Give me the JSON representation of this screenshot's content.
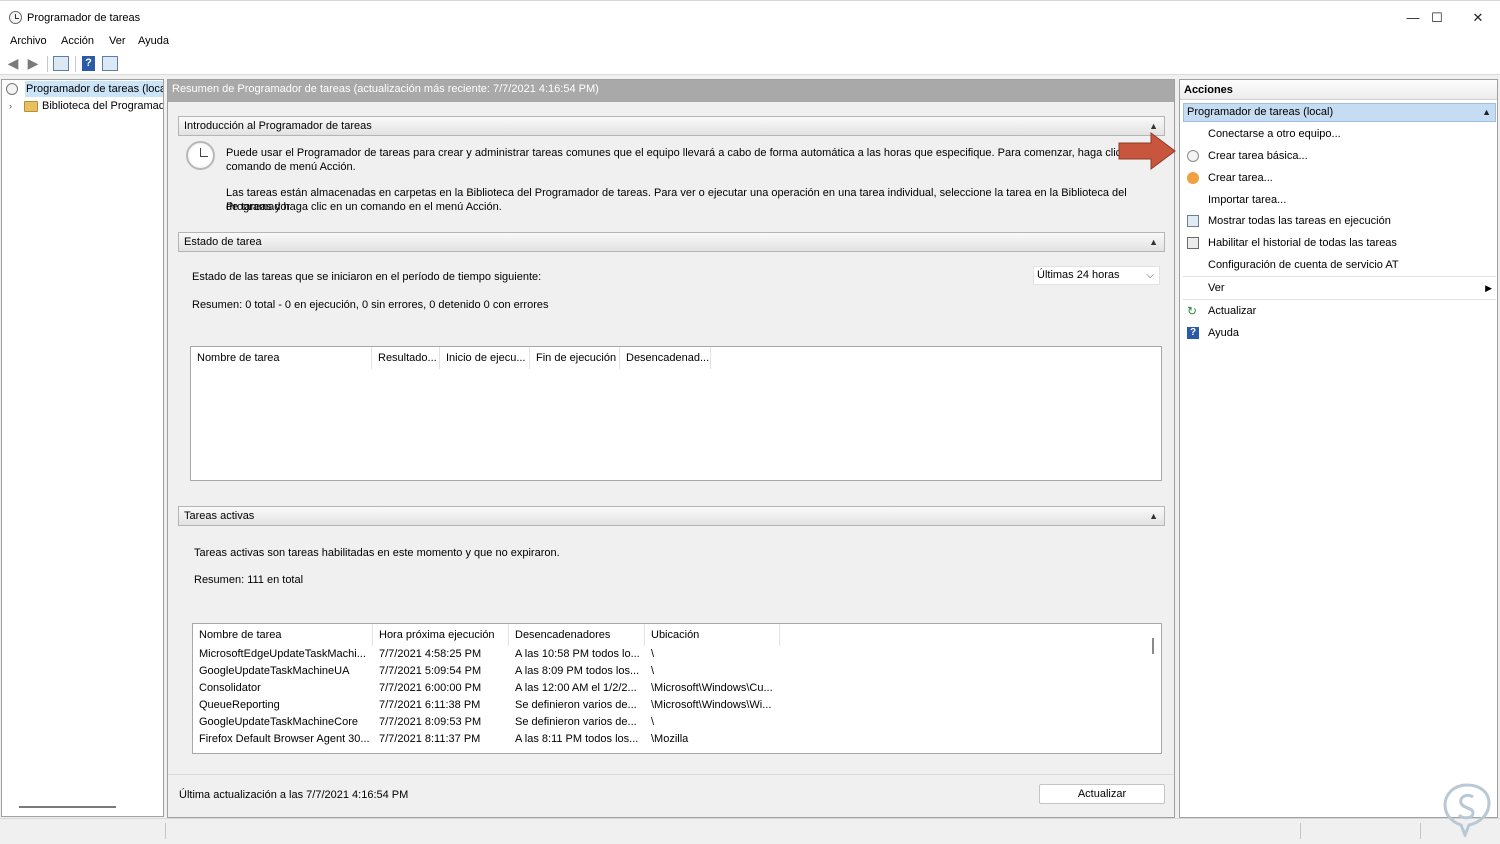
{
  "window": {
    "title": "Programador de tareas",
    "controls": {
      "minimize": "—",
      "maximize": "☐",
      "close": "✕"
    }
  },
  "menu": [
    "Archivo",
    "Acción",
    "Ver",
    "Ayuda"
  ],
  "tree": {
    "root": "Programador de tareas (local)",
    "child": "Biblioteca del Programador de tareas"
  },
  "center": {
    "header": "Resumen de Programador de tareas (actualización más reciente: 7/7/2021 4:16:54 PM)",
    "intro": {
      "title": "Introducción al Programador de tareas",
      "p1_line1": "Puede usar el Programador de tareas para crear y administrar tareas comunes que el equipo llevará a cabo de forma automática a las horas que especifique. Para comenzar, haga clic en un",
      "p1_line2": "comando de menú Acción.",
      "p2_line1": "Las tareas están almacenadas en carpetas en la Biblioteca del Programador de tareas. Para ver o ejecutar una operación en una tarea individual, seleccione la tarea en la Biblioteca del Programador",
      "p2_line2": "de tareas y haga clic en un comando en el menú Acción."
    },
    "status": {
      "title": "Estado de tarea",
      "period_label": "Estado de las tareas que se iniciaron en el período de tiempo siguiente:",
      "period_value": "Últimas 24 horas",
      "summary": "Resumen: 0 total - 0 en ejecución, 0 sin errores, 0 detenido  0 con errores",
      "columns": [
        "Nombre de tarea",
        "Resultado...",
        "Inicio de ejecu...",
        "Fin de ejecución",
        "Desencadenad..."
      ]
    },
    "active": {
      "title": "Tareas activas",
      "description": "Tareas activas son tareas habilitadas en este momento y que no expiraron.",
      "summary": "Resumen: 111 en total",
      "columns": [
        "Nombre de tarea",
        "Hora próxima ejecución",
        "Desencadenadores",
        "Ubicación"
      ],
      "rows": [
        [
          "MicrosoftEdgeUpdateTaskMachi...",
          "7/7/2021 4:58:25 PM",
          "A las 10:58 PM todos lo...",
          "\\"
        ],
        [
          "GoogleUpdateTaskMachineUA",
          "7/7/2021 5:09:54 PM",
          "A las 8:09 PM todos los...",
          "\\"
        ],
        [
          "Consolidator",
          "7/7/2021 6:00:00 PM",
          "A las 12:00 AM el 1/2/2...",
          "\\Microsoft\\Windows\\Cu..."
        ],
        [
          "QueueReporting",
          "7/7/2021 6:11:38 PM",
          "Se definieron varios de...",
          "\\Microsoft\\Windows\\Wi..."
        ],
        [
          "GoogleUpdateTaskMachineCore",
          "7/7/2021 8:09:53 PM",
          "Se definieron varios de...",
          "\\"
        ],
        [
          "Firefox Default Browser Agent 30...",
          "7/7/2021 8:11:37 PM",
          "A las 8:11 PM todos los...",
          "\\Mozilla"
        ]
      ]
    },
    "footer": {
      "last_update": "Última actualización a las 7/7/2021 4:16:54 PM",
      "refresh_button": "Actualizar"
    }
  },
  "actions": {
    "title": "Acciones",
    "group": "Programador de tareas (local)",
    "items": [
      "Conectarse a otro equipo...",
      "Crear tarea básica...",
      "Crear tarea...",
      "Importar tarea...",
      "Mostrar todas las tareas en ejecución",
      "Habilitar el historial de todas las tareas",
      "Configuración de cuenta de servicio AT",
      "Ver",
      "Actualizar",
      "Ayuda"
    ]
  },
  "colors": {
    "header_gray": "#a9a9a9",
    "selection_blue": "#c6dcf2",
    "arrow_red": "#c8553d"
  }
}
